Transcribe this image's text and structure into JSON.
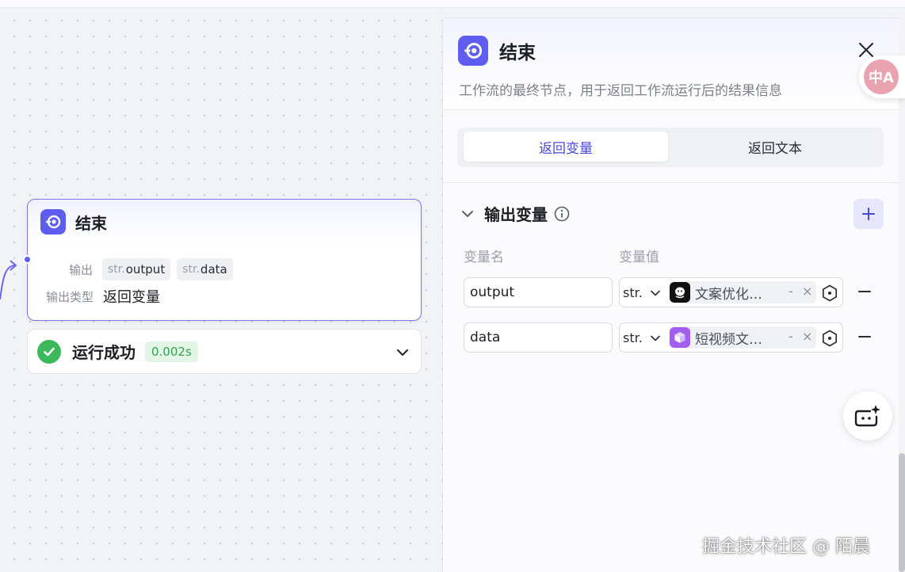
{
  "node": {
    "title": "结束",
    "output_label": "输出",
    "outputs": [
      {
        "type": "str.",
        "name": "output"
      },
      {
        "type": "str.",
        "name": "data"
      }
    ],
    "output_type_label": "输出类型",
    "output_type_value": "返回变量"
  },
  "run": {
    "status": "运行成功",
    "time": "0.002s"
  },
  "panel": {
    "title": "结束",
    "description": "工作流的最终节点，用于返回工作流运行后的结果信息",
    "tabs": [
      {
        "label": "返回变量",
        "active": true
      },
      {
        "label": "返回文本",
        "active": false
      }
    ],
    "section_title": "输出变量",
    "col_name": "变量名",
    "col_value": "变量值",
    "rows": [
      {
        "name": "output",
        "type": "str.",
        "ref": "文案优化…",
        "ref_icon": "wechat-bot-icon"
      },
      {
        "name": "data",
        "type": "str.",
        "ref": "短视频文…",
        "ref_icon": "cube-icon"
      }
    ],
    "ref_dash": "-",
    "ref_clear": "×"
  },
  "translate_badge": "中A",
  "watermark": "掘金技术社区 @ 陌晨",
  "colors": {
    "accent": "#5f5cf0",
    "success": "#3cb85d",
    "tab_active_text": "#4b48d8"
  }
}
